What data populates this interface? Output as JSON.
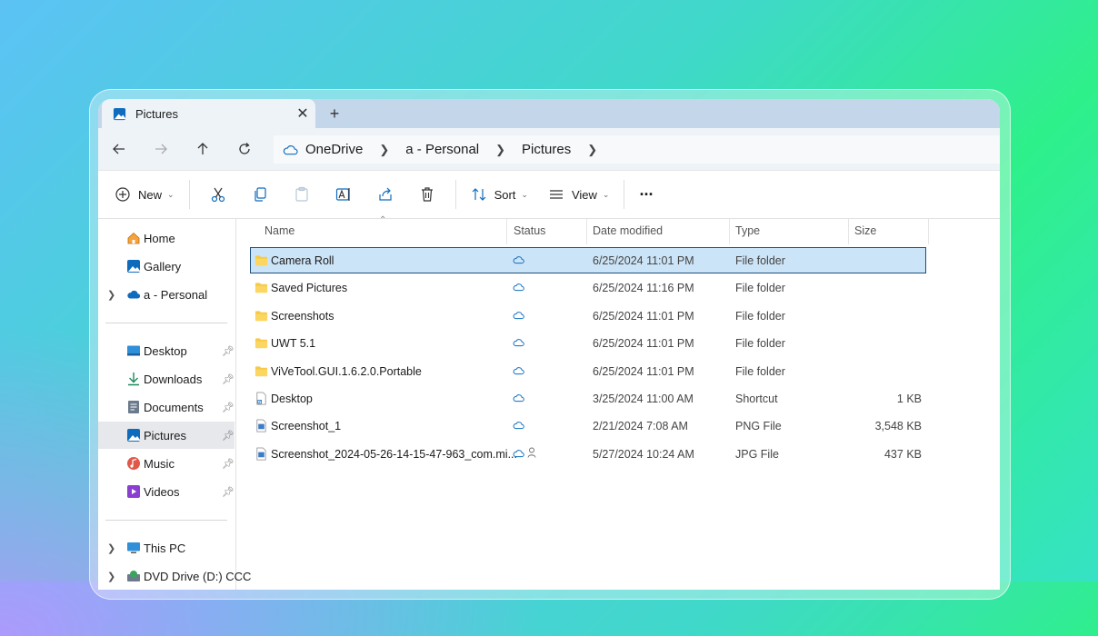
{
  "window": {
    "tab_title": "Pictures",
    "tab_icon": "pictures-folder-icon",
    "new_tab_label": "+",
    "close_label": "✕"
  },
  "navigation": {
    "breadcrumb": [
      "OneDrive",
      "a - Personal",
      "Pictures"
    ]
  },
  "toolbar": {
    "new_label": "New",
    "sort_label": "Sort",
    "view_label": "View",
    "more_label": "···"
  },
  "sidebar": {
    "quick": [
      {
        "label": "Home",
        "icon": "home-icon"
      },
      {
        "label": "Gallery",
        "icon": "gallery-icon"
      },
      {
        "label": "a - Personal",
        "icon": "onedrive-cloud-icon"
      }
    ],
    "pinned": [
      {
        "label": "Desktop",
        "icon": "desktop-icon"
      },
      {
        "label": "Downloads",
        "icon": "downloads-icon"
      },
      {
        "label": "Documents",
        "icon": "documents-icon"
      },
      {
        "label": "Pictures",
        "icon": "pictures-icon",
        "selected": true
      },
      {
        "label": "Music",
        "icon": "music-icon"
      },
      {
        "label": "Videos",
        "icon": "videos-icon"
      }
    ],
    "devices": [
      {
        "label": "This PC",
        "icon": "this-pc-icon"
      },
      {
        "label": "DVD Drive (D:) CCC",
        "icon": "dvd-drive-icon"
      }
    ]
  },
  "columns": [
    "Name",
    "Status",
    "Date modified",
    "Type",
    "Size"
  ],
  "files": [
    {
      "name": "Camera Roll",
      "date": "6/25/2024 11:01 PM",
      "type": "File folder",
      "size": "",
      "kind": "folder",
      "selected": true
    },
    {
      "name": "Saved Pictures",
      "date": "6/25/2024 11:16 PM",
      "type": "File folder",
      "size": "",
      "kind": "folder"
    },
    {
      "name": "Screenshots",
      "date": "6/25/2024 11:01 PM",
      "type": "File folder",
      "size": "",
      "kind": "folder"
    },
    {
      "name": "UWT 5.1",
      "date": "6/25/2024 11:01 PM",
      "type": "File folder",
      "size": "",
      "kind": "folder"
    },
    {
      "name": "ViVeTool.GUI.1.6.2.0.Portable",
      "date": "6/25/2024 11:01 PM",
      "type": "File folder",
      "size": "",
      "kind": "folder"
    },
    {
      "name": "Desktop",
      "date": "3/25/2024 11:00 AM",
      "type": "Shortcut",
      "size": "1 KB",
      "kind": "shortcut"
    },
    {
      "name": "Screenshot_1",
      "date": "2/21/2024 7:08 AM",
      "type": "PNG File",
      "size": "3,548 KB",
      "kind": "image"
    },
    {
      "name": "Screenshot_2024-05-26-14-15-47-963_com.mi...",
      "date": "5/27/2024 10:24 AM",
      "type": "JPG File",
      "size": "437 KB",
      "kind": "image",
      "shared": true
    }
  ],
  "colors": {
    "accent": "#0f6cbd",
    "selection": "#cce4f7",
    "folder": "#f7c948"
  }
}
